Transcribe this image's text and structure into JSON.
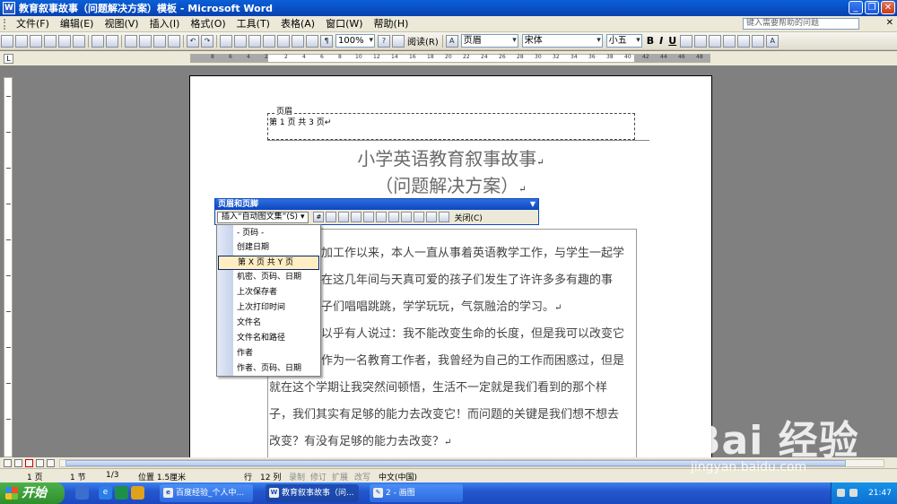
{
  "window": {
    "title": "教育叙事故事（问题解决方案）模板 - Microsoft Word",
    "buttons": [
      "_",
      "❐",
      "✕"
    ]
  },
  "menu": {
    "items": [
      "文件(F)",
      "编辑(E)",
      "视图(V)",
      "插入(I)",
      "格式(O)",
      "工具(T)",
      "表格(A)",
      "窗口(W)",
      "帮助(H)"
    ],
    "help_placeholder": "键入需要帮助的问题"
  },
  "toolbar": {
    "zoom": "100%",
    "read_label": "阅读(R)",
    "style": "页眉",
    "font": "宋体",
    "size": "小五",
    "bold": "B",
    "italic": "I",
    "underline": "U"
  },
  "ruler": {
    "numbers": [
      "8",
      "6",
      "4",
      "2",
      "",
      "2",
      "4",
      "6",
      "8",
      "10",
      "12",
      "14",
      "16",
      "18",
      "20",
      "22",
      "24",
      "26",
      "28",
      "30",
      "32",
      "34",
      "36",
      "38",
      "40",
      "42",
      "44",
      "46",
      "48"
    ]
  },
  "document": {
    "header_label": "页眉",
    "header_text": "第 1 页 共 3 页",
    "title_line1": "小学英语教育叙事故事",
    "title_line2": "（问题解决方案）",
    "paragraph_lines": [
      "加工作以来，本人一直从事着英语教学工作，与学生一起学",
      "在这几年间与天真可爱的孩子们发生了许许多多有趣的事",
      "子们唱唱跳跳，学学玩玩，气氛融洽的学习。",
      "以乎有人说过：我不能改变生命的长度，但是我可以改变它",
      "作为一名教育工作者，我曾经为自己的工作而困惑过，但是",
      "就在这个学期让我突然间顿悟，生活不一定就是我们看到的那个样",
      "子，我们其实有足够的能力去改变它！而问题的关键是我们想不想去",
      "改变？有没有足够的能力去改变？"
    ],
    "para_mark": "↵"
  },
  "hf_toolbar": {
    "title": "页眉和页脚",
    "insert_label": "插入“自动图文集”(S)",
    "close_label": "关闭(C)"
  },
  "autotext_menu": {
    "items": [
      "- 页码 -",
      "创建日期",
      "第 X 页 共 Y 页",
      "机密、页码、日期",
      "上次保存者",
      "上次打印时间",
      "文件名",
      "文件名和路径",
      "作者",
      "作者、页码、日期"
    ],
    "highlighted_index": 2
  },
  "statusbar": {
    "page": "1 页",
    "section": "1 节",
    "page_of": "1/3",
    "position": "位置 1.5厘米",
    "line": "行",
    "col": "12 列",
    "rec": "录制",
    "trk": "修订",
    "ext": "扩展",
    "ovr": "改写",
    "language": "中文(中国)"
  },
  "taskbar": {
    "start_label": "开始",
    "tasks": [
      "百度经验_个人中...",
      "教育叙事故事（问...",
      "2 - 画图"
    ],
    "clock": "21:47"
  },
  "watermark": {
    "logo": "Bai  经验",
    "url": "jingyan.baidu.com"
  }
}
